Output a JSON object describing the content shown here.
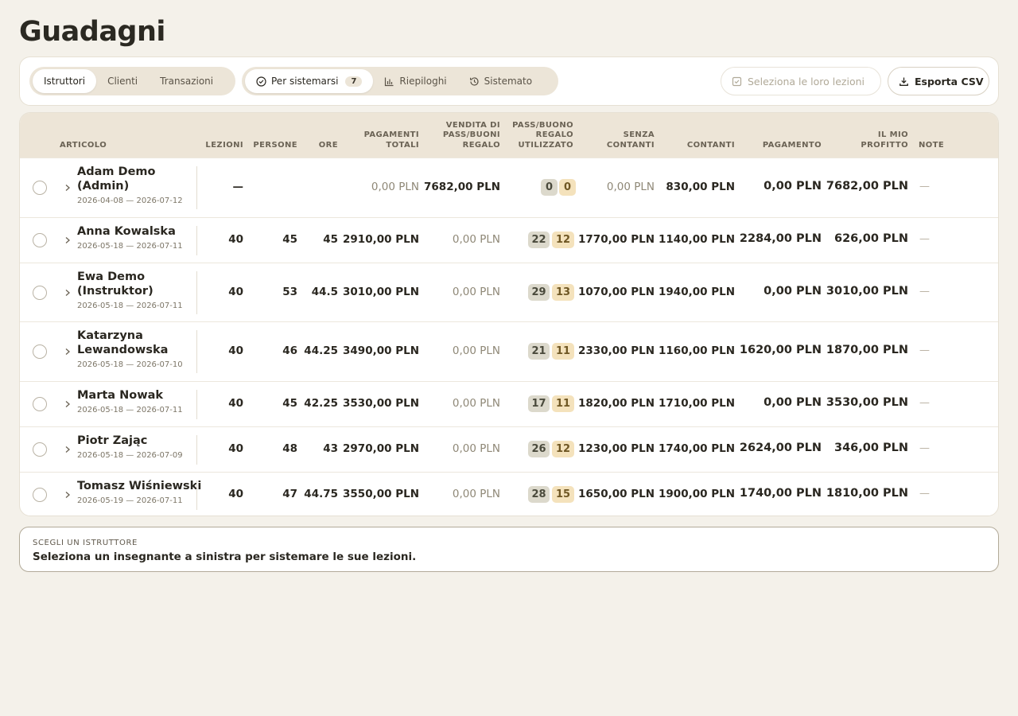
{
  "page": {
    "title": "Guadagni"
  },
  "tabs": {
    "group": [
      "Istruttori",
      "Clienti",
      "Transazioni"
    ],
    "active_group": "Istruttori",
    "status": [
      {
        "label": "Per sistemarsi",
        "badge": "7",
        "icon": "check-circle-icon"
      },
      {
        "label": "Riepiloghi",
        "icon": "bar-chart-icon"
      },
      {
        "label": "Sistemato",
        "icon": "history-icon"
      }
    ],
    "active_status": "Per sistemarsi"
  },
  "actions": {
    "select_label": "Seleziona le loro lezioni",
    "export_label": "Esporta CSV"
  },
  "table": {
    "headers": {
      "articolo": "ARTICOLO",
      "lezioni": "LEZIONI",
      "persone": "PERSONE",
      "ore": "ORE",
      "pagamenti": [
        "PAGAMENTI",
        "TOTALI"
      ],
      "vendita": [
        "VENDITA DI",
        "PASS/BUONI",
        "REGALO"
      ],
      "pass": [
        "PASS/BUONO",
        "REGALO",
        "UTILIZZATO"
      ],
      "senza": [
        "SENZA",
        "CONTANTI"
      ],
      "contanti": "CONTANTI",
      "pagamento": "PAGAMENTO",
      "profitto": [
        "IL MIO",
        "PROFITTO"
      ],
      "note": "NOTE"
    },
    "rows": [
      {
        "name": "Adam Demo (Admin)",
        "dates": "2026-04-08 — 2026-07-12",
        "lezioni": "—",
        "persone": "",
        "ore": "",
        "pagamenti": "0,00 PLN",
        "vendita": "7682,00 PLN",
        "pass_g": "0",
        "pass_y": "0",
        "senza": "0,00 PLN",
        "contanti": "830,00 PLN",
        "pagamento": "0,00 PLN",
        "profitto": "7682,00 PLN",
        "note": "—"
      },
      {
        "name": "Anna Kowalska",
        "dates": "2026-05-18 — 2026-07-11",
        "lezioni": "40",
        "persone": "45",
        "ore": "45",
        "pagamenti": "2910,00 PLN",
        "vendita": "0,00 PLN",
        "pass_g": "22",
        "pass_y": "12",
        "senza": "1770,00 PLN",
        "contanti": "1140,00 PLN",
        "pagamento": "2284,00 PLN",
        "profitto": "626,00 PLN",
        "note": "—"
      },
      {
        "name": "Ewa Demo (Instruktor)",
        "dates": "2026-05-18 — 2026-07-11",
        "lezioni": "40",
        "persone": "53",
        "ore": "44.5",
        "pagamenti": "3010,00 PLN",
        "vendita": "0,00 PLN",
        "pass_g": "29",
        "pass_y": "13",
        "senza": "1070,00 PLN",
        "contanti": "1940,00 PLN",
        "pagamento": "0,00 PLN",
        "profitto": "3010,00 PLN",
        "note": "—"
      },
      {
        "name": "Katarzyna Lewandowska",
        "dates": "2026-05-18 — 2026-07-10",
        "lezioni": "40",
        "persone": "46",
        "ore": "44.25",
        "pagamenti": "3490,00 PLN",
        "vendita": "0,00 PLN",
        "pass_g": "21",
        "pass_y": "11",
        "senza": "2330,00 PLN",
        "contanti": "1160,00 PLN",
        "pagamento": "1620,00 PLN",
        "profitto": "1870,00 PLN",
        "note": "—"
      },
      {
        "name": "Marta Nowak",
        "dates": "2026-05-18 — 2026-07-11",
        "lezioni": "40",
        "persone": "45",
        "ore": "42.25",
        "pagamenti": "3530,00 PLN",
        "vendita": "0,00 PLN",
        "pass_g": "17",
        "pass_y": "11",
        "senza": "1820,00 PLN",
        "contanti": "1710,00 PLN",
        "pagamento": "0,00 PLN",
        "profitto": "3530,00 PLN",
        "note": "—"
      },
      {
        "name": "Piotr Zając",
        "dates": "2026-05-18 — 2026-07-09",
        "lezioni": "40",
        "persone": "48",
        "ore": "43",
        "pagamenti": "2970,00 PLN",
        "vendita": "0,00 PLN",
        "pass_g": "26",
        "pass_y": "12",
        "senza": "1230,00 PLN",
        "contanti": "1740,00 PLN",
        "pagamento": "2624,00 PLN",
        "profitto": "346,00 PLN",
        "note": "—"
      },
      {
        "name": "Tomasz Wiśniewski",
        "dates": "2026-05-19 — 2026-07-11",
        "lezioni": "40",
        "persone": "47",
        "ore": "44.75",
        "pagamenti": "3550,00 PLN",
        "vendita": "0,00 PLN",
        "pass_g": "28",
        "pass_y": "15",
        "senza": "1650,00 PLN",
        "contanti": "1900,00 PLN",
        "pagamento": "1740,00 PLN",
        "profitto": "1810,00 PLN",
        "note": "—"
      }
    ]
  },
  "panel": {
    "label": "SCEGLI UN ISTRUTTORE",
    "text": "Seleziona un insegnante a sinistra per sistemare le sue lezioni."
  },
  "colors": {
    "background": "#f4f1ea",
    "header": "#ede5d7",
    "pill_gray": "#dcd9cc",
    "pill_yellow": "#f4e2bc"
  }
}
